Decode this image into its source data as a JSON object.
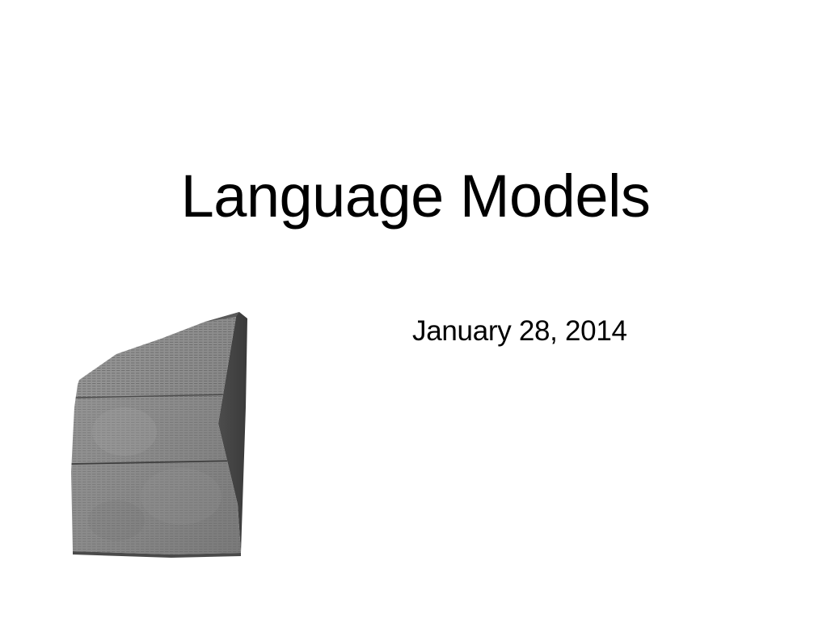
{
  "slide": {
    "title": "Language Models",
    "date": "January 28, 2014"
  },
  "image": {
    "depicts": "rosetta-stone",
    "tone": "#8a8a8a"
  }
}
